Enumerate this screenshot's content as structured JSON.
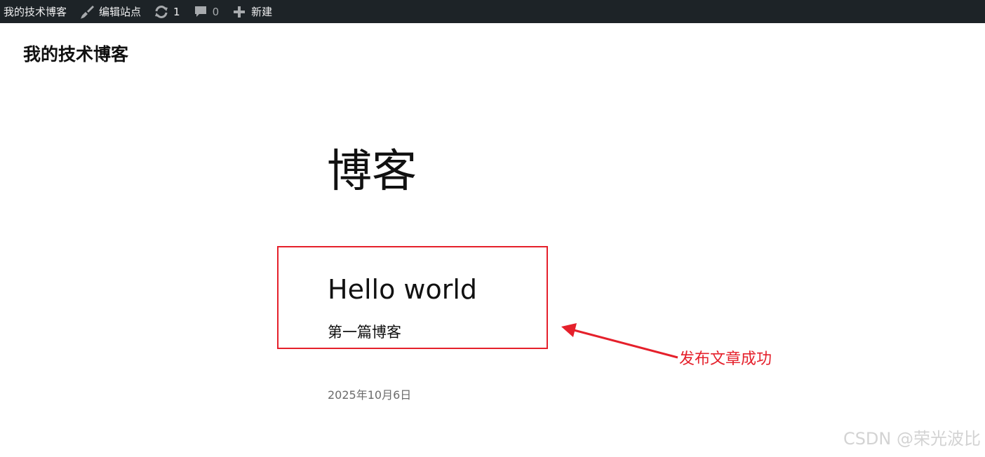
{
  "adminbar": {
    "site_name": "我的技术博客",
    "edit_site": "编辑站点",
    "updates_count": "1",
    "comments_count": "0",
    "new_label": "新建",
    "icons": {
      "customize": "paintbrush-icon",
      "updates": "refresh-icon",
      "comments": "comment-bubble-icon",
      "new": "plus-icon"
    }
  },
  "header": {
    "site_title": "我的技术博客"
  },
  "main": {
    "heading": "博客",
    "post": {
      "title": "Hello world",
      "excerpt": "第一篇博客",
      "date": "2025年10月6日"
    }
  },
  "annotation": {
    "label": "发布文章成功",
    "color": "#e5202b"
  },
  "watermark": {
    "text": "CSDN @荣光波比"
  },
  "colors": {
    "adminbar_bg": "#1d2327",
    "adminbar_text": "#f0f0f1",
    "annotation_red": "#e5202b"
  }
}
